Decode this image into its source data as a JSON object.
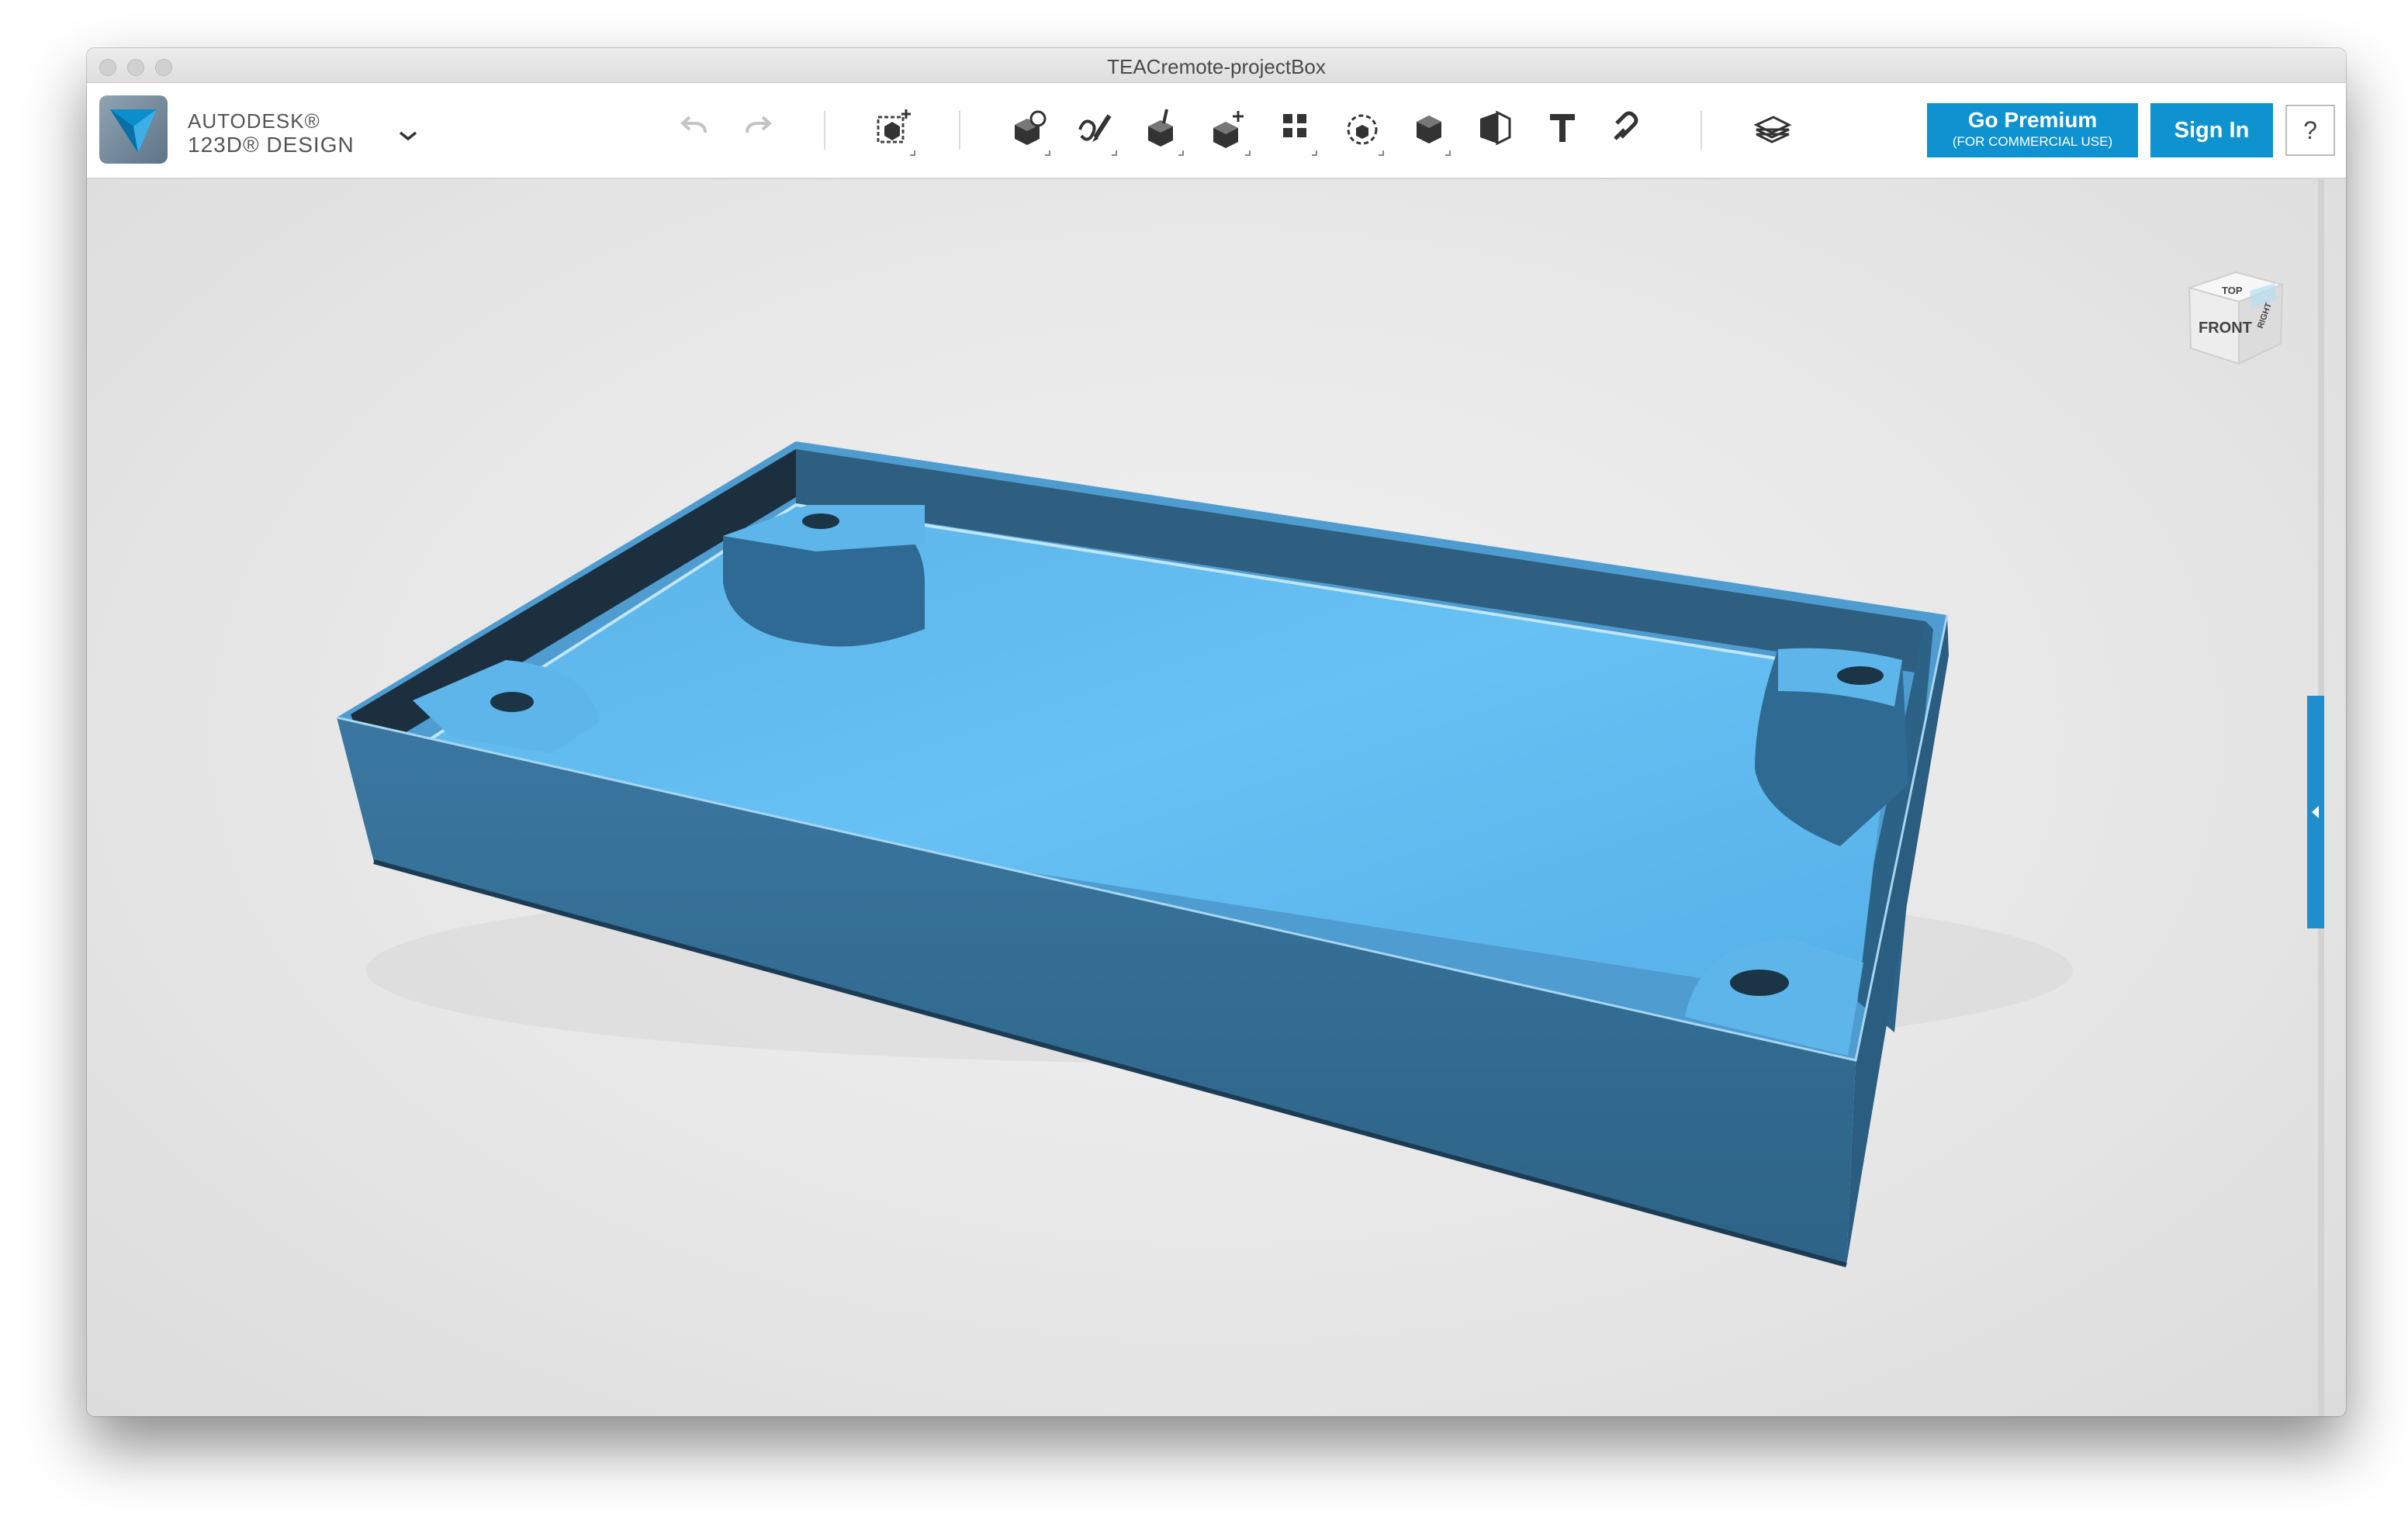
{
  "window": {
    "title": "TEACremote-projectBox"
  },
  "brand": {
    "company": "AUTODESK®",
    "product": "123D® DESIGN"
  },
  "toolbar": {
    "tools": [
      {
        "name": "undo-icon",
        "enabled": false
      },
      {
        "name": "redo-icon",
        "enabled": false
      },
      {
        "name": "transform-icon"
      },
      {
        "name": "primitives-icon"
      },
      {
        "name": "sketch-icon"
      },
      {
        "name": "construct-icon"
      },
      {
        "name": "modify-icon"
      },
      {
        "name": "pattern-icon"
      },
      {
        "name": "grouping-icon"
      },
      {
        "name": "combine-icon"
      },
      {
        "name": "measure-icon"
      },
      {
        "name": "text-icon"
      },
      {
        "name": "snap-icon"
      },
      {
        "name": "material-icon"
      }
    ]
  },
  "buttons": {
    "premium_label": "Go Premium",
    "premium_sub": "(FOR COMMERCIAL USE)",
    "signin_label": "Sign In",
    "help_label": "?"
  },
  "viewcube": {
    "top": "TOP",
    "front": "FRONT",
    "right": "RIGHT"
  },
  "colors": {
    "accent": "#0f93d0",
    "model_light": "#5db8ef",
    "model_dark": "#2f6388"
  }
}
